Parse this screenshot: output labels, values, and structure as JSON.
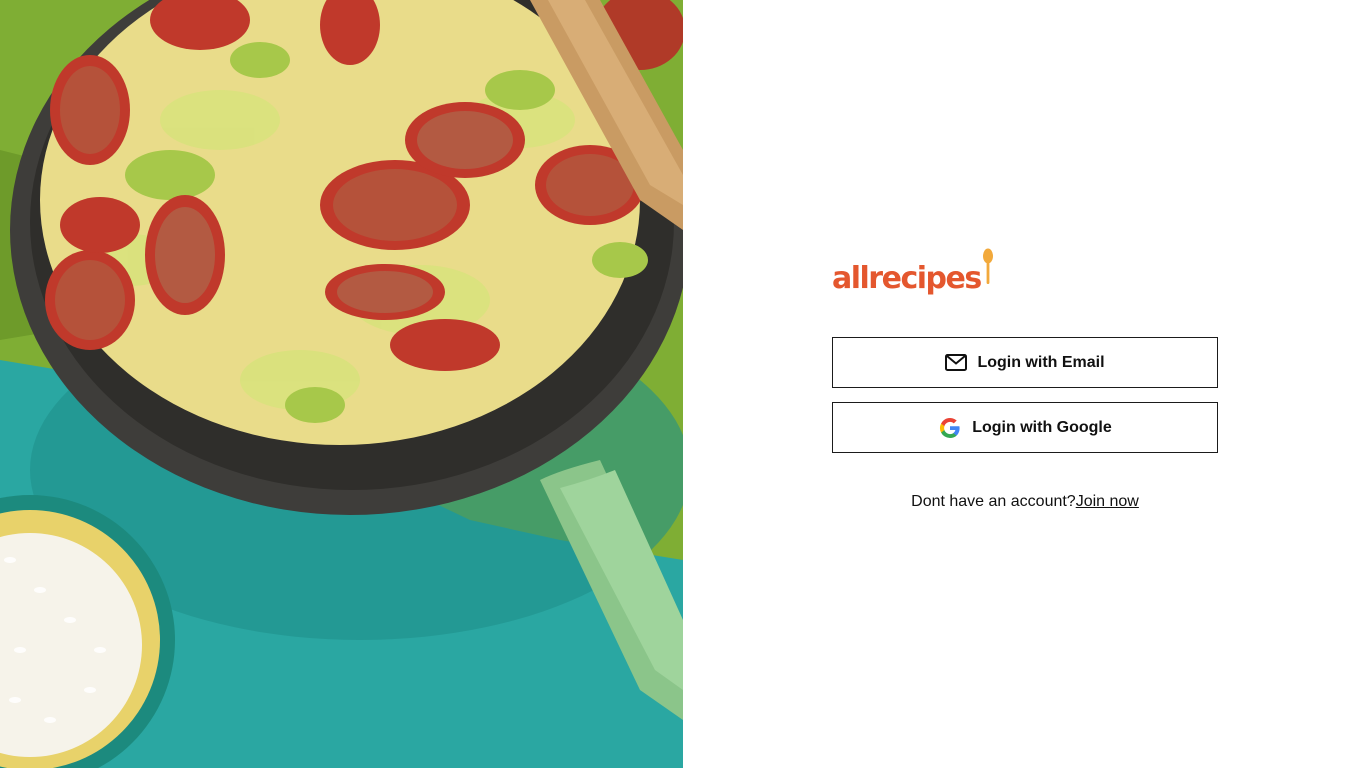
{
  "brand": {
    "name": "allrecipes",
    "accent_color": "#e4572e",
    "spoon_color": "#f2a93b"
  },
  "hero": {
    "icon": "food-photo-skillet-sausage-cabbage"
  },
  "login": {
    "email_button_label": "Login with Email",
    "email_icon": "envelope-icon",
    "google_button_label": "Login with Google",
    "google_icon": "google-g-icon"
  },
  "signup": {
    "prompt": "Dont have an account?",
    "link_label": "Join now"
  }
}
